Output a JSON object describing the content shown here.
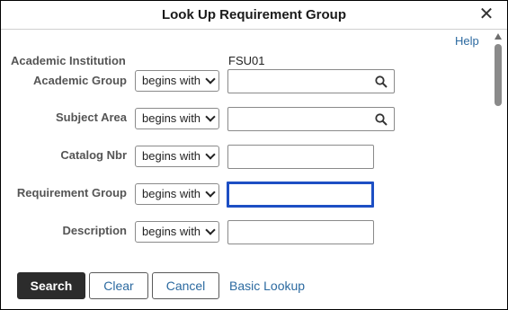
{
  "dialog": {
    "title": "Look Up Requirement Group",
    "close_glyph": "✕",
    "help_label": "Help"
  },
  "institution": {
    "label": "Academic Institution",
    "value": "FSU01"
  },
  "fields": [
    {
      "label": "Academic Group",
      "operator": "begins with",
      "value": "",
      "has_lookup": true
    },
    {
      "label": "Subject Area",
      "operator": "begins with",
      "value": "",
      "has_lookup": true
    },
    {
      "label": "Catalog Nbr",
      "operator": "begins with",
      "value": "",
      "has_lookup": false
    },
    {
      "label": "Requirement Group",
      "operator": "begins with",
      "value": "",
      "has_lookup": false,
      "focused": true
    },
    {
      "label": "Description",
      "operator": "begins with",
      "value": "",
      "has_lookup": false
    }
  ],
  "buttons": {
    "search": "Search",
    "clear": "Clear",
    "cancel": "Cancel",
    "basic_lookup": "Basic Lookup"
  },
  "icons": {
    "close": "close-icon",
    "lookup": "search-icon",
    "dropdown": "chevron-down-icon",
    "scroll_up": "arrow-up-icon"
  },
  "colors": {
    "link": "#2c6aa0",
    "primary_button": "#2c2c2c",
    "focus_border": "#1d4fc4"
  }
}
